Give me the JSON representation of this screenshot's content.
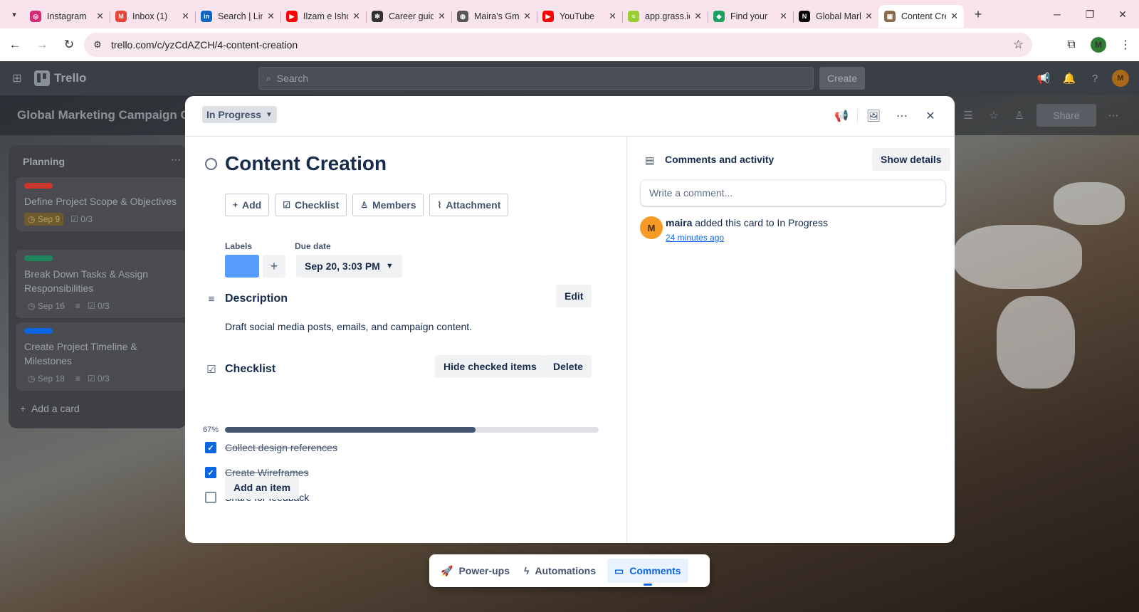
{
  "browser": {
    "tabs": [
      {
        "title": "Instagram",
        "favicon": "instagram-icon",
        "color": "#d62976",
        "glyph": "◎"
      },
      {
        "title": "Inbox (1)",
        "favicon": "gmail-icon",
        "color": "#ea4335",
        "glyph": "M"
      },
      {
        "title": "Search | LinkedIn",
        "favicon": "linkedin-icon",
        "color": "#0a66c2",
        "glyph": "in"
      },
      {
        "title": "Ilzam e Ishq",
        "favicon": "youtube-icon",
        "color": "#ff0000",
        "glyph": "▶"
      },
      {
        "title": "Career guide",
        "favicon": "chatgpt-icon",
        "color": "#333333",
        "glyph": "✻"
      },
      {
        "title": "Maira's Gmail",
        "favicon": "globe-icon",
        "color": "#555555",
        "glyph": "◍"
      },
      {
        "title": "YouTube",
        "favicon": "youtube-icon",
        "color": "#ff0000",
        "glyph": "▶"
      },
      {
        "title": "app.grass.io",
        "favicon": "grass-icon",
        "color": "#9acd32",
        "glyph": "≈"
      },
      {
        "title": "Find your",
        "favicon": "gem-icon",
        "color": "#1aa260",
        "glyph": "◆"
      },
      {
        "title": "Global Marketing",
        "favicon": "notion-icon",
        "color": "#000000",
        "glyph": "N"
      },
      {
        "title": "Content Creation",
        "favicon": "trello-icon",
        "color": "#8a6b4a",
        "glyph": "▣",
        "active": true
      }
    ],
    "url": "trello.com/c/yzCdAZCH/4-content-creation",
    "profile_initial": "M"
  },
  "trello": {
    "app_name": "Trello",
    "search_placeholder": "Search",
    "create_label": "Create",
    "avatar_initial": "M",
    "board_title": "Global Marketing Campaign Co",
    "share_label": "Share",
    "list": {
      "title": "Planning",
      "cards": [
        {
          "title": "Define Project Scope & Objectives",
          "label_color": "#c9372c",
          "due": "Sep 9",
          "checklist": "0/3",
          "due_style": "red"
        },
        {
          "title": "Break Down Tasks & Assign Responsibilities",
          "label_color": "#1f845a",
          "due": "Sep 16",
          "checklist": "0/3",
          "due_style": "plain"
        },
        {
          "title": "Create Project Timeline & Milestones",
          "label_color": "#0c66e4",
          "due": "Sep 18",
          "checklist": "0/3",
          "due_style": "plain"
        }
      ],
      "add_card": "Add a card"
    }
  },
  "modal": {
    "status": "In Progress",
    "title": "Content Creation",
    "actions": [
      {
        "label": "Add",
        "icon": "plus-icon",
        "glyph": "+"
      },
      {
        "label": "Checklist",
        "icon": "checklist-icon",
        "glyph": "☑"
      },
      {
        "label": "Members",
        "icon": "members-icon",
        "glyph": "♙"
      },
      {
        "label": "Attachment",
        "icon": "paperclip-icon",
        "glyph": "⌇"
      }
    ],
    "labels_heading": "Labels",
    "label_color": "#579dff",
    "due_heading": "Due date",
    "due_value": "Sep 20, 3:03 PM",
    "description": {
      "heading": "Description",
      "edit_label": "Edit",
      "text": "Draft social media posts, emails, and campaign content."
    },
    "checklist": {
      "heading": "Checklist",
      "hide_label": "Hide checked items",
      "delete_label": "Delete",
      "percent_label": "67%",
      "progress": 0.67,
      "items": [
        {
          "text": "Collect design references",
          "checked": true
        },
        {
          "text": "Create Wireframes",
          "checked": true
        },
        {
          "text": "Share for feedback",
          "checked": false
        }
      ],
      "add_item_label": "Add an item"
    },
    "activity": {
      "heading": "Comments and activity",
      "show_details_label": "Show details",
      "comment_placeholder": "Write a comment...",
      "entries": [
        {
          "avatar": "M",
          "user": "maira",
          "action": "added this card to In Progress",
          "time": "24 minutes ago"
        }
      ]
    }
  },
  "bottom_bar": {
    "items": [
      {
        "label": "Power-ups",
        "icon": "rocket-icon",
        "glyph": "🚀"
      },
      {
        "label": "Automations",
        "icon": "lightning-icon",
        "glyph": "ϟ"
      },
      {
        "label": "Comments",
        "icon": "comment-icon",
        "glyph": "▭",
        "active": true
      }
    ]
  }
}
